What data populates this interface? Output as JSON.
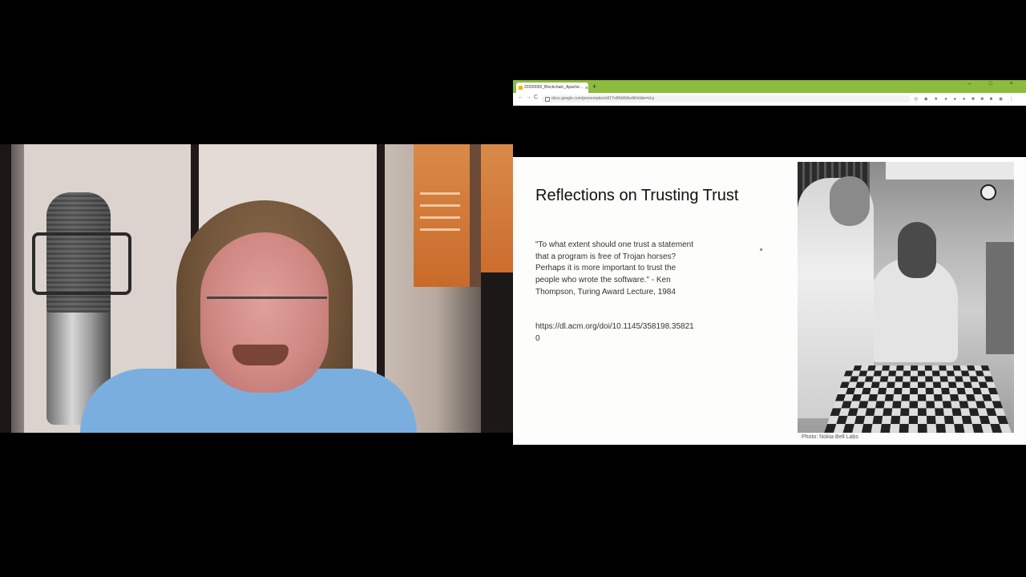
{
  "browser": {
    "tab_title": "20200000_Blockchain_Apache...",
    "url": "docs.google.com/presentation/d/1Yz8hb8d/edit#slide=id.p",
    "new_tab_symbol": "+",
    "close_symbol": "×",
    "window_controls": "– □ ×",
    "nav": {
      "back": "←",
      "forward": "→",
      "reload": "C"
    },
    "extensions": "◎ ◆ ★ ● ● ● ■ ■ ■ ◉ ⋮"
  },
  "slide": {
    "title": "Reflections on Trusting Trust",
    "quote": "\"To what extent should one trust a statement that a program is free of Trojan horses? Perhaps it is more important to trust the people who wrote the software.\" - Ken Thompson, Turing Award Lecture, 1984",
    "link": "https://dl.acm.org/doi/10.1145/358198.358210",
    "photo_credit": "Photo: Nokia Bell Labs"
  },
  "colors": {
    "browser_tabbar": "#8dbb3d",
    "slide_background": "#fdfdfb",
    "shirt": "#7aaedf"
  }
}
